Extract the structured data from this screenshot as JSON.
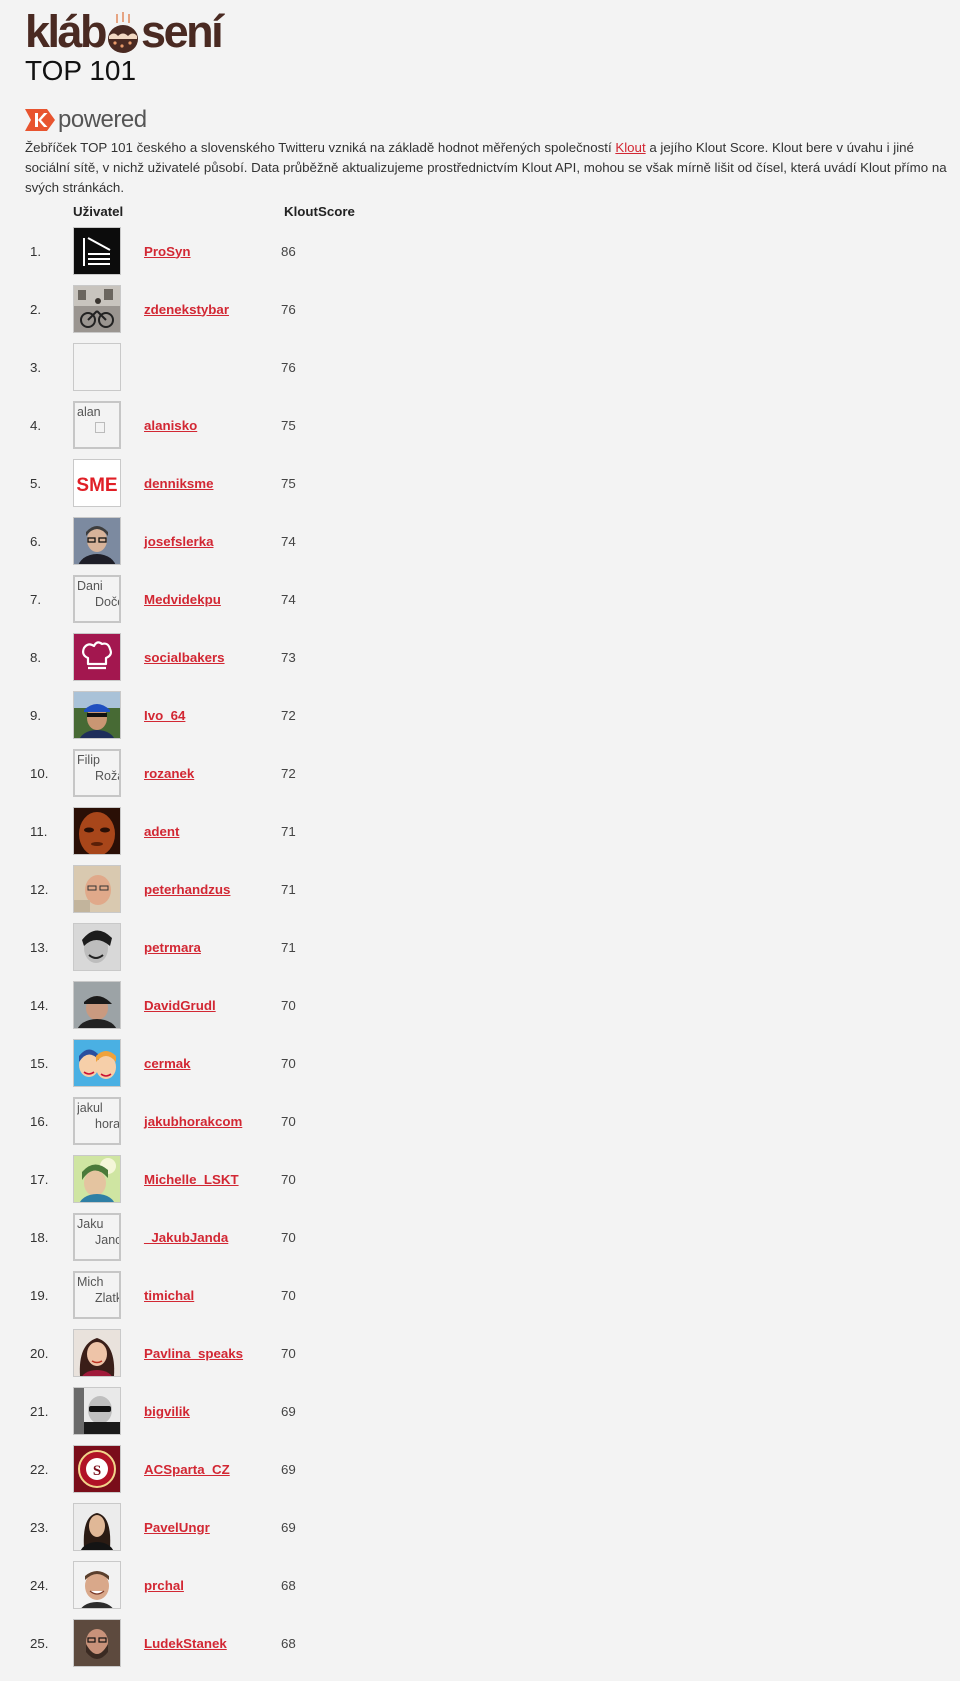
{
  "header": {
    "logo_before": "kláb",
    "logo_after": "sení",
    "title": "TOP 101"
  },
  "powered": {
    "label": "powered"
  },
  "intro": {
    "text_1": "Žebříček TOP 101 českého a slovenského Twitteru vzniká na základě hodnot měřených společností ",
    "link": "Klout",
    "text_2": " a jejího Klout Score. Klout bere v úvahu i jiné sociální sítě, v nichž uživatelé působí. Data průběžně aktualizujeme prostřednictvím Klout API, mohou se však mírně lišit od čísel, která uvádí Klout přímo na svých stránkách."
  },
  "table": {
    "col_user": "Uživatel",
    "col_score": "KloutScore",
    "rows": [
      {
        "rank": "1.",
        "user": "ProSyn",
        "score": "86",
        "avatar": "prosyn"
      },
      {
        "rank": "2.",
        "user": "zdenekstybar",
        "score": "76",
        "avatar": "photo-street"
      },
      {
        "rank": "3.",
        "user": "",
        "score": "76",
        "avatar": "empty"
      },
      {
        "rank": "4.",
        "user": "alanisko",
        "score": "75",
        "avatar": "broken",
        "alt1": "alan",
        "alt2": ""
      },
      {
        "rank": "5.",
        "user": "denniksme",
        "score": "75",
        "avatar": "sme",
        "logo_text": "SME"
      },
      {
        "rank": "6.",
        "user": "josefslerka",
        "score": "74",
        "avatar": "photo-man-glasses"
      },
      {
        "rank": "7.",
        "user": "Medvidekpu",
        "score": "74",
        "avatar": "broken",
        "alt1": "Dani",
        "alt2": "Doče"
      },
      {
        "rank": "8.",
        "user": "socialbakers",
        "score": "73",
        "avatar": "socialbakers"
      },
      {
        "rank": "9.",
        "user": "Ivo_64",
        "score": "72",
        "avatar": "photo-cap"
      },
      {
        "rank": "10.",
        "user": "rozanek",
        "score": "72",
        "avatar": "broken",
        "alt1": "Filip",
        "alt2": "Roža"
      },
      {
        "rank": "11.",
        "user": "adent",
        "score": "71",
        "avatar": "photo-dark-orange"
      },
      {
        "rank": "12.",
        "user": "peterhandzus",
        "score": "71",
        "avatar": "photo-bald"
      },
      {
        "rank": "13.",
        "user": "petrmara",
        "score": "71",
        "avatar": "photo-bw-smile"
      },
      {
        "rank": "14.",
        "user": "DavidGrudl",
        "score": "70",
        "avatar": "photo-cap-gray"
      },
      {
        "rank": "15.",
        "user": "cermak",
        "score": "70",
        "avatar": "comic"
      },
      {
        "rank": "16.",
        "user": "jakubhorakcom",
        "score": "70",
        "avatar": "broken",
        "alt1": "jakul",
        "alt2": "hora"
      },
      {
        "rank": "17.",
        "user": "Michelle_LSKT",
        "score": "70",
        "avatar": "photo-green"
      },
      {
        "rank": "18.",
        "user": "_JakubJanda",
        "score": "70",
        "avatar": "broken",
        "alt1": "Jaku",
        "alt2": "Janc"
      },
      {
        "rank": "19.",
        "user": "timichal",
        "score": "70",
        "avatar": "broken",
        "alt1": "Mich",
        "alt2": "Zlatk"
      },
      {
        "rank": "20.",
        "user": "Pavlina_speaks",
        "score": "70",
        "avatar": "photo-woman"
      },
      {
        "rank": "21.",
        "user": "bigvilik",
        "score": "69",
        "avatar": "photo-bw-sunglasses"
      },
      {
        "rank": "22.",
        "user": "ACSparta_CZ",
        "score": "69",
        "avatar": "sparta"
      },
      {
        "rank": "23.",
        "user": "PavelUngr",
        "score": "69",
        "avatar": "photo-longhair"
      },
      {
        "rank": "24.",
        "user": "prchal",
        "score": "68",
        "avatar": "photo-white-smile"
      },
      {
        "rank": "25.",
        "user": "LudekStanek",
        "score": "68",
        "avatar": "photo-beard"
      }
    ]
  },
  "colors": {
    "link": "#d22733",
    "logo": "#4a2a22",
    "background": "#f3f3f3",
    "klout": "#e8542f"
  }
}
